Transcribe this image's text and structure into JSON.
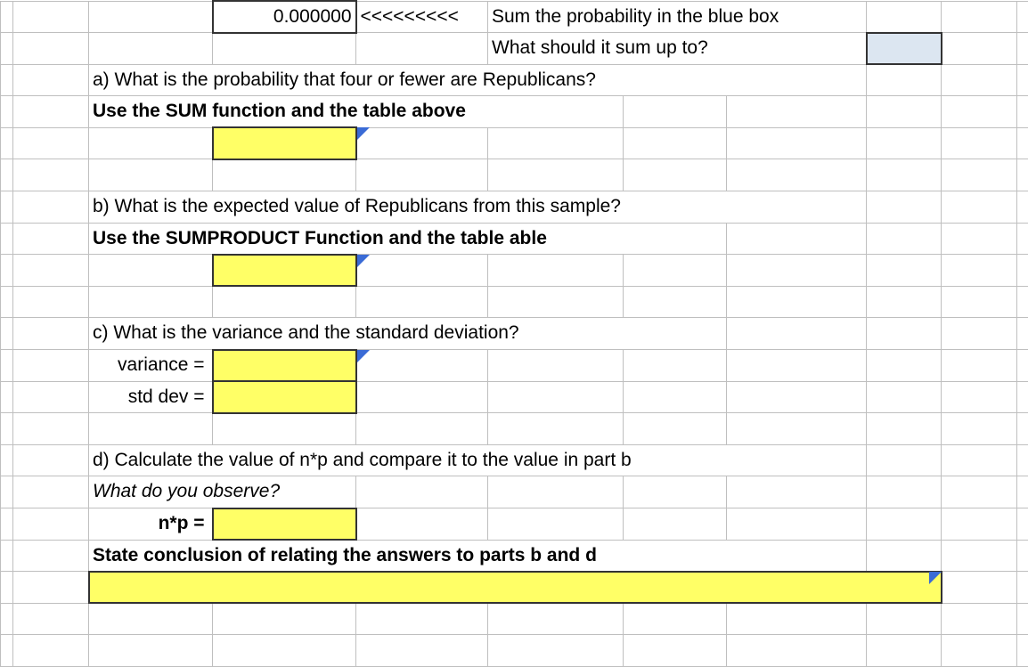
{
  "row1": {
    "value": "0.000000",
    "arrows": "<<<<<<<<<",
    "label": "Sum the probability in the blue box"
  },
  "row2": {
    "label": "What should it sum up to?"
  },
  "qa": {
    "prompt": "a) What is the probability that four or fewer are Republicans?",
    "instr": "Use the SUM function and the table above"
  },
  "qb": {
    "prompt": "b) What is the expected value of Republicans from this sample?",
    "instr": "Use the SUMPRODUCT Function and the table able"
  },
  "qc": {
    "prompt": "c) What is the variance and the standard deviation?",
    "var_label": "variance =",
    "std_label": "std dev ="
  },
  "qd": {
    "prompt": "d)  Calculate the value of n*p and compare it to the value in part b",
    "observe": "What do you observe?",
    "np_label": "n*p =",
    "conclusion": "State conclusion of relating the answers to parts b and d"
  }
}
